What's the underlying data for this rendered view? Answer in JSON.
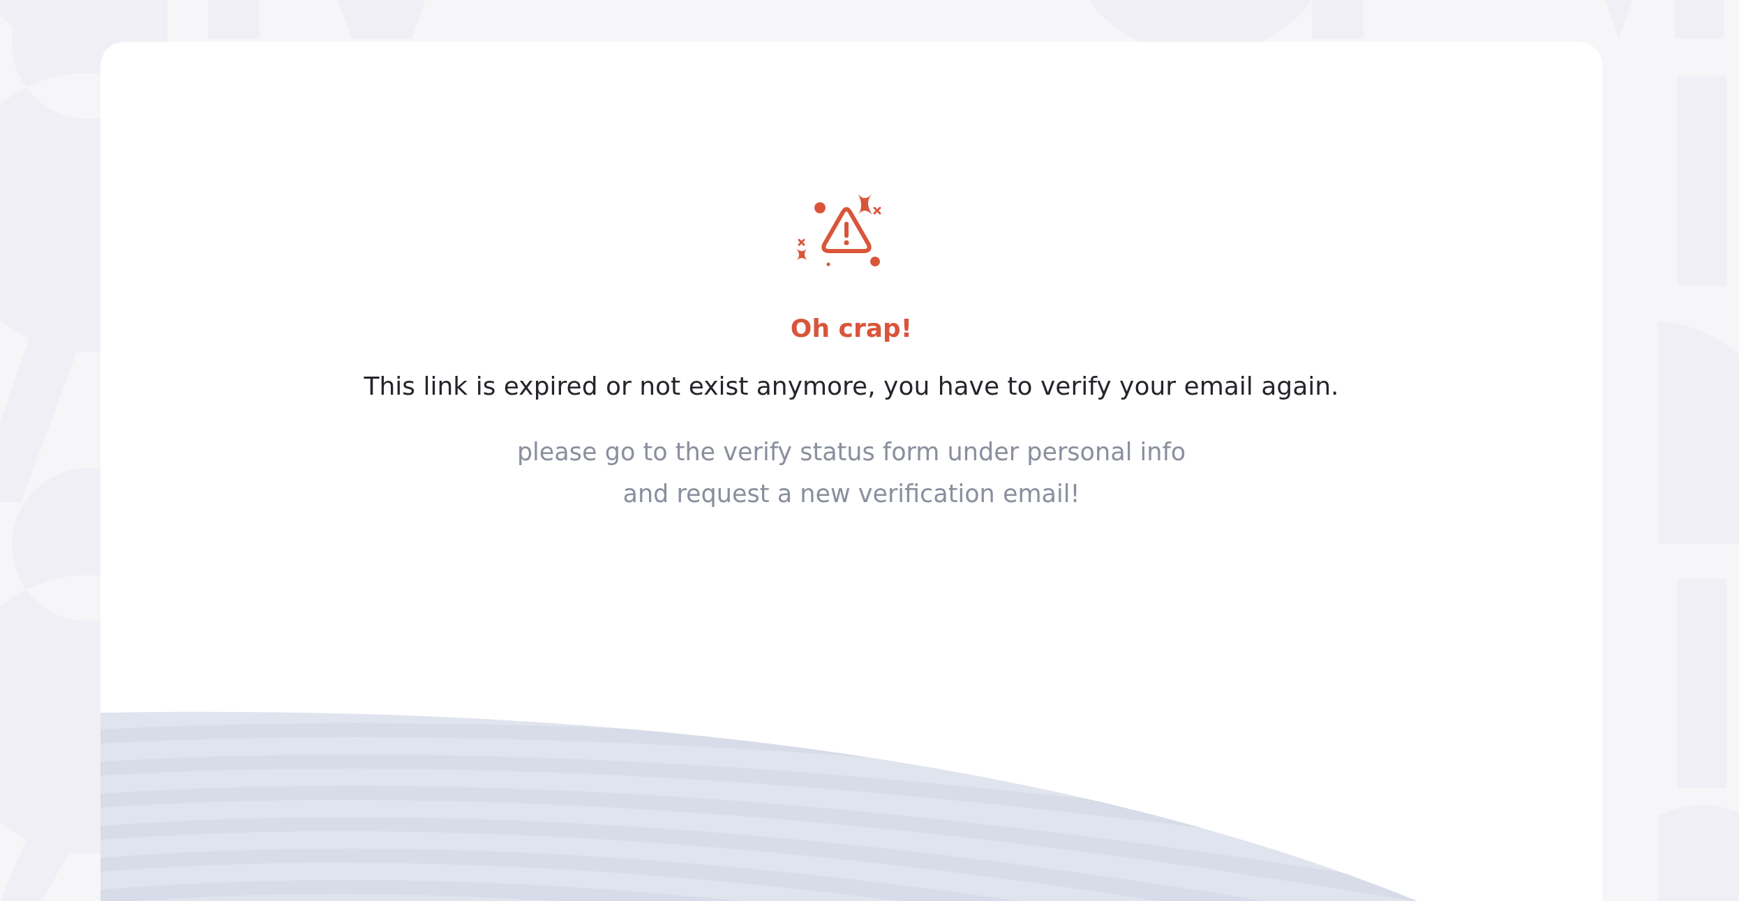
{
  "alert": {
    "title": "Oh crap!",
    "message": "This link is expired or not exist anymore, you have to verify your email again.",
    "hint_lines": [
      "please go to the verify status form under personal info",
      "and request a new verification email!"
    ]
  }
}
